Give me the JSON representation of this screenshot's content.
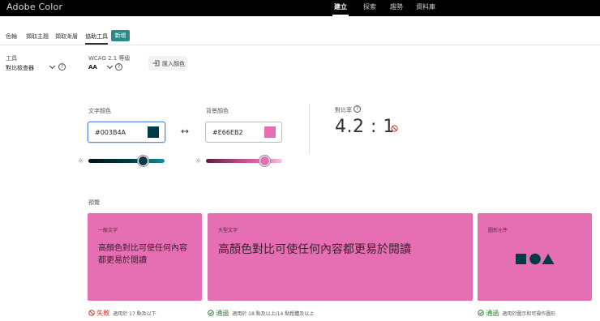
{
  "header": {
    "brand": "Adobe Color",
    "nav": [
      "建立",
      "探索",
      "趨勢",
      "資料庫"
    ],
    "active_nav": "建立"
  },
  "subtabs": {
    "items": [
      "色輪",
      "擷取主題",
      "擷取漸層",
      "協助工具"
    ],
    "active": "協助工具",
    "new_badge": "新增"
  },
  "tools": {
    "tool_label": "工具",
    "tool_value": "對比檢查器",
    "wcag_label": "WCAG 2.1 等級",
    "wcag_value": "AA",
    "import_label": "匯入顏色"
  },
  "colors": {
    "text_label": "文字顏色",
    "text_hex": "#003B4A",
    "text_swatch": "#003b4a",
    "bg_label": "背景顏色",
    "bg_hex": "#E66EB2",
    "bg_swatch": "#e66eb2",
    "text_slider_level": 0.72,
    "bg_slider_level": 0.77
  },
  "contrast": {
    "label": "對比率",
    "ratio": "4.2 : 1"
  },
  "preview": {
    "label": "預覽",
    "card_bg": "#e66eb2",
    "cards": [
      {
        "title": "一般文字",
        "text": "高顏色對比可使任何內容都更易於閱讀",
        "status": "失敗",
        "note": "適用於 17 點及以下",
        "passed": false
      },
      {
        "title": "大型文字",
        "text": "高顏色對比可使任何內容都更易於閱讀",
        "status": "通過",
        "note": "適用於 18 點及以上/14 點粗體及以上",
        "passed": true
      },
      {
        "title": "圖形元件",
        "status": "通過",
        "note": "適用於圖示和可操作圖形",
        "passed": true
      }
    ]
  },
  "icons": {
    "swap": "swap-arrows-icon",
    "brightness": "sun-icon",
    "fail": "prohibited-icon",
    "pass": "check-circle-icon",
    "help": "help-icon",
    "import": "import-icon",
    "shapes": [
      "square-icon",
      "circle-icon",
      "triangle-icon"
    ]
  }
}
